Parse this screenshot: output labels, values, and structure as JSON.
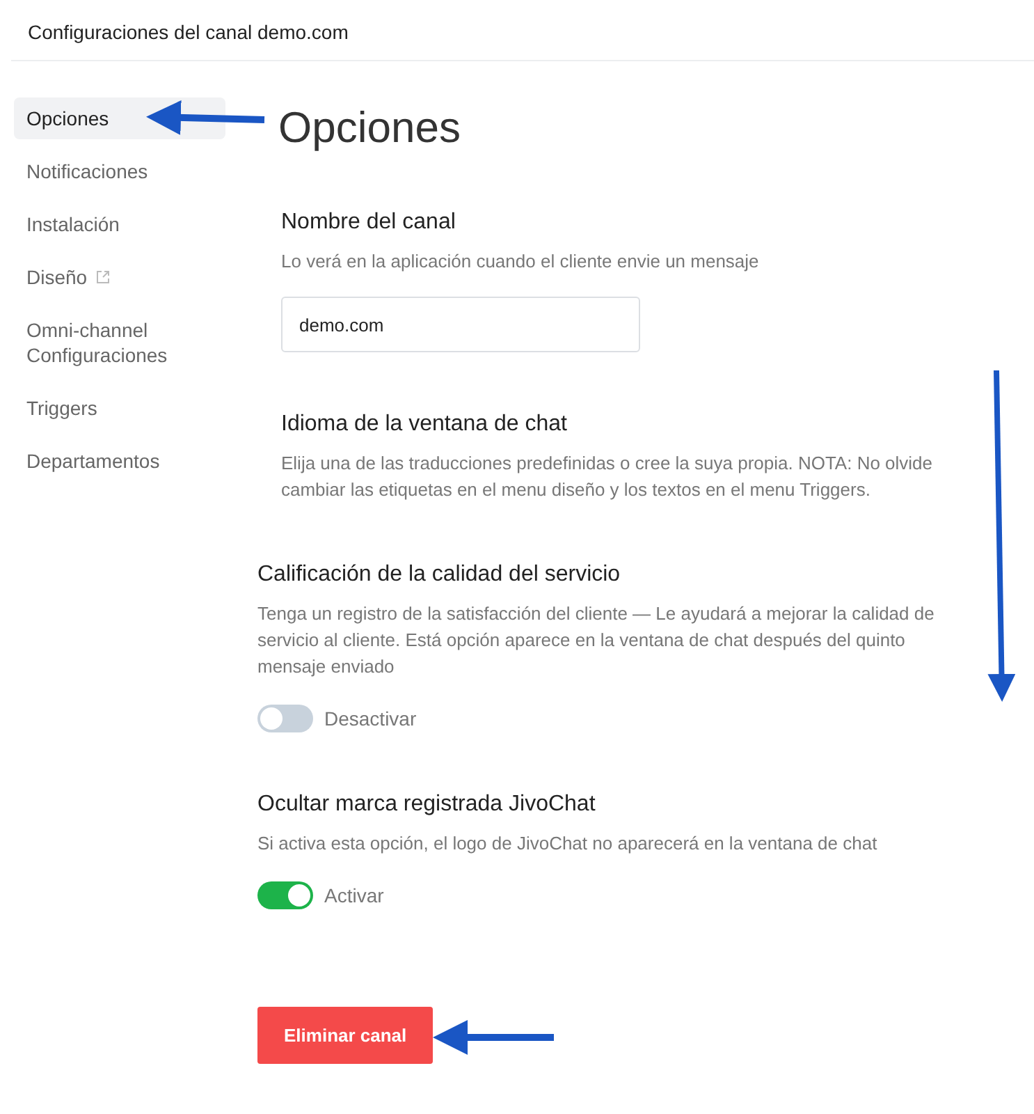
{
  "header": {
    "title": "Configuraciones del canal demo.com"
  },
  "sidebar": {
    "items": [
      {
        "label": "Opciones",
        "selected": true,
        "external": false
      },
      {
        "label": "Notificaciones",
        "selected": false,
        "external": false
      },
      {
        "label": "Instalación",
        "selected": false,
        "external": false
      },
      {
        "label": "Diseño",
        "selected": false,
        "external": true
      },
      {
        "label": "Omni-channel Configuraciones",
        "selected": false,
        "external": false
      },
      {
        "label": "Triggers",
        "selected": false,
        "external": false
      },
      {
        "label": "Departamentos",
        "selected": false,
        "external": false
      }
    ]
  },
  "heading": "Opciones",
  "sections": [
    {
      "kind": "field",
      "title": "Nombre del canal",
      "description": "Lo verá en la aplicación cuando el cliente envie un mensaje",
      "value": "demo.com"
    },
    {
      "kind": "info",
      "title": "Idioma de la ventana de chat",
      "description": "Elija una de las traducciones predefinidas o cree la suya propia. NOTA: No olvide cambiar las etiquetas en el menu diseño y los textos en el menu Triggers."
    },
    {
      "kind": "toggle",
      "title": "Calificación de la calidad del servicio",
      "description": "Tenga un registro de la satisfacción del cliente — Le ayudará a mejorar la calidad de servicio al cliente. Está opción aparece en la ventana de chat después del quinto mensaje enviado",
      "on": false,
      "label": "Desactivar"
    },
    {
      "kind": "toggle",
      "title": "Ocultar marca registrada JivoChat",
      "description": "Si activa esta opción, el logo de JivoChat no aparecerá en la ventana de chat",
      "on": true,
      "label": "Activar"
    }
  ],
  "delete_button": "Eliminar canal"
}
